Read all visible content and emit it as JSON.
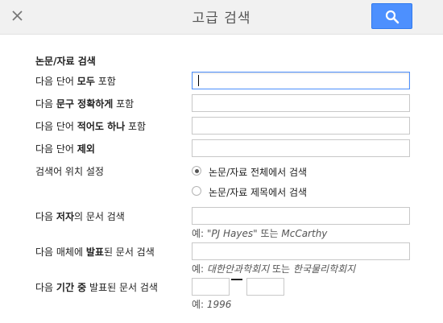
{
  "header": {
    "title": "고급 검색"
  },
  "form": {
    "section_title": "논문/자료 검색",
    "all_words": {
      "label_pre": "다음 단어 ",
      "label_bold": "모두",
      "label_post": " 포함"
    },
    "exact_phrase": {
      "label_pre": "다음 ",
      "label_bold": "문구 정확하게",
      "label_post": " 포함"
    },
    "at_least_one": {
      "label_pre": "다음 단어 ",
      "label_bold": "적어도 하나",
      "label_post": " 포함"
    },
    "without_words": {
      "label_pre": "다음 단어 ",
      "label_bold": "제외",
      "label_post": ""
    },
    "occurrence": {
      "label": "검색어 위치 설정",
      "options": [
        "논문/자료 전체에서 검색",
        "논문/자료 제목에서 검색"
      ],
      "selected_index": 0
    },
    "author": {
      "label_pre": "다음 ",
      "label_bold": "저자",
      "label_post": "의 문서 검색",
      "hint_prefix": "예: ",
      "hint_ex1": "\"PJ Hayes\"",
      "hint_mid": " 또는 ",
      "hint_ex2": "McCarthy"
    },
    "publication": {
      "label_pre": "다음 매체에 ",
      "label_bold": "발표",
      "label_post": "된 문서 검색",
      "hint_prefix": "예: ",
      "hint_ex1": "대한안과학회지",
      "hint_mid": " 또는 ",
      "hint_ex2": "한국물리학회지"
    },
    "date_range": {
      "label_pre": "다음 ",
      "label_bold": "기간 중",
      "label_post": " 발표된 문서 검색",
      "hint_prefix": "예: ",
      "hint_ex1": "1996"
    }
  },
  "colors": {
    "accent": "#4d90fe",
    "header_bg": "#f1f1f1"
  }
}
